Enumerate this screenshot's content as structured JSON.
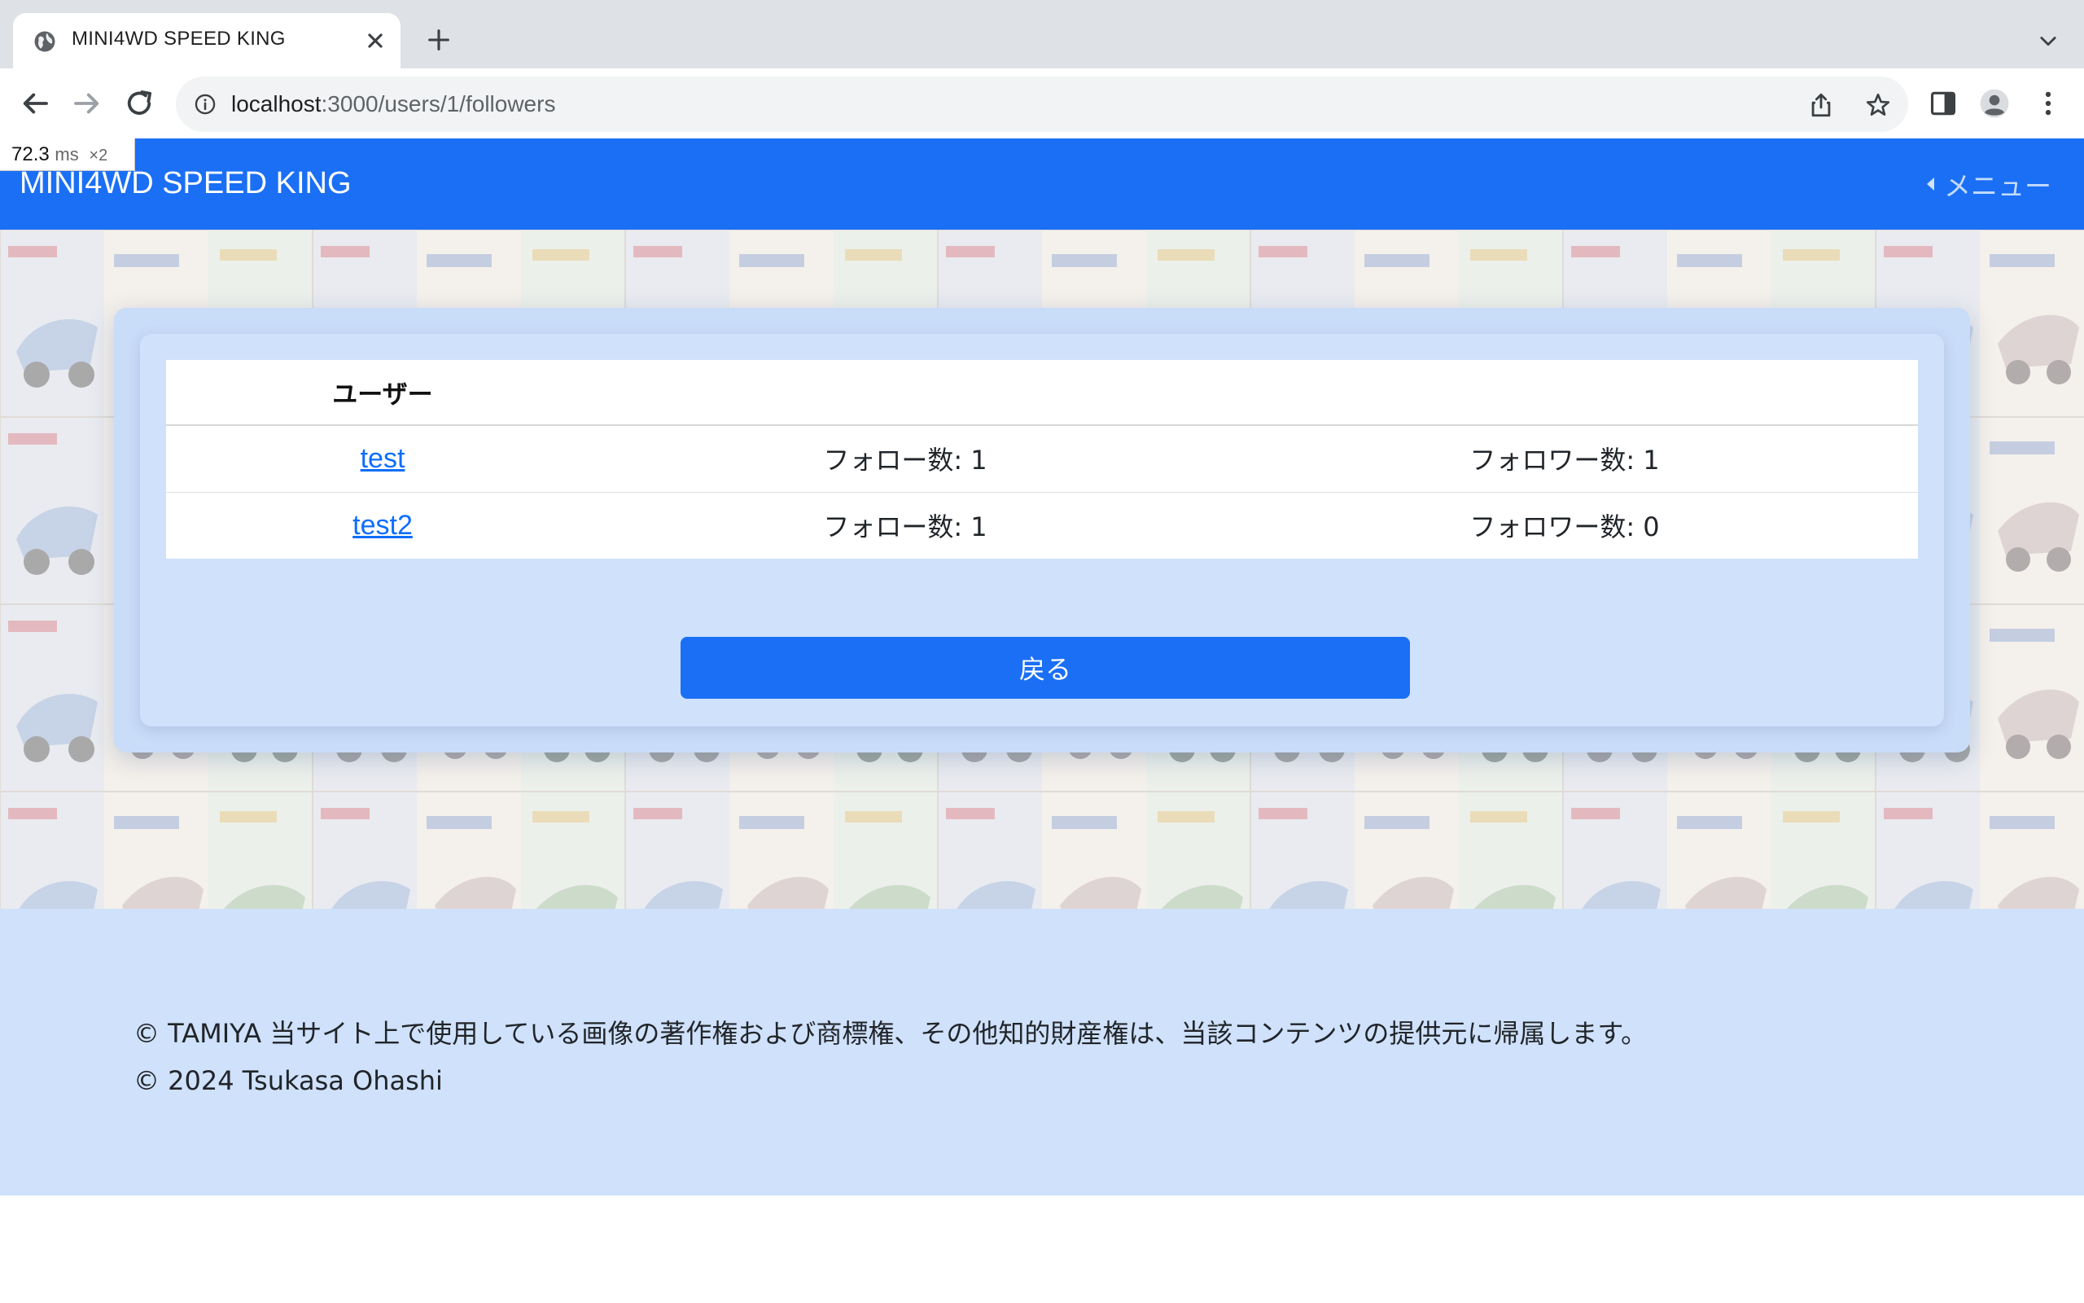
{
  "browser": {
    "tab_title": "MINI4WD SPEED KING",
    "url_host": "localhost",
    "url_path": ":3000/users/1/followers",
    "perf_value": "72.3",
    "perf_unit": "ms",
    "perf_multiplier": "×2"
  },
  "navbar": {
    "brand": "MINI4WD SPEED KING",
    "menu_label": "メニュー",
    "color": "#1a6ff5"
  },
  "table": {
    "header": "ユーザー",
    "rows": [
      {
        "name": "test",
        "follows": "フォロー数: 1",
        "followers": "フォロワー数: 1"
      },
      {
        "name": "test2",
        "follows": "フォロー数: 1",
        "followers": "フォロワー数: 0"
      }
    ]
  },
  "back_button": "戻る",
  "footer": {
    "line1": "© TAMIYA 当サイト上で使用している画像の著作権および商標権、その他知的財産権は、当該コンテンツの提供元に帰属します。",
    "line2": "© 2024 Tsukasa Ohashi"
  }
}
